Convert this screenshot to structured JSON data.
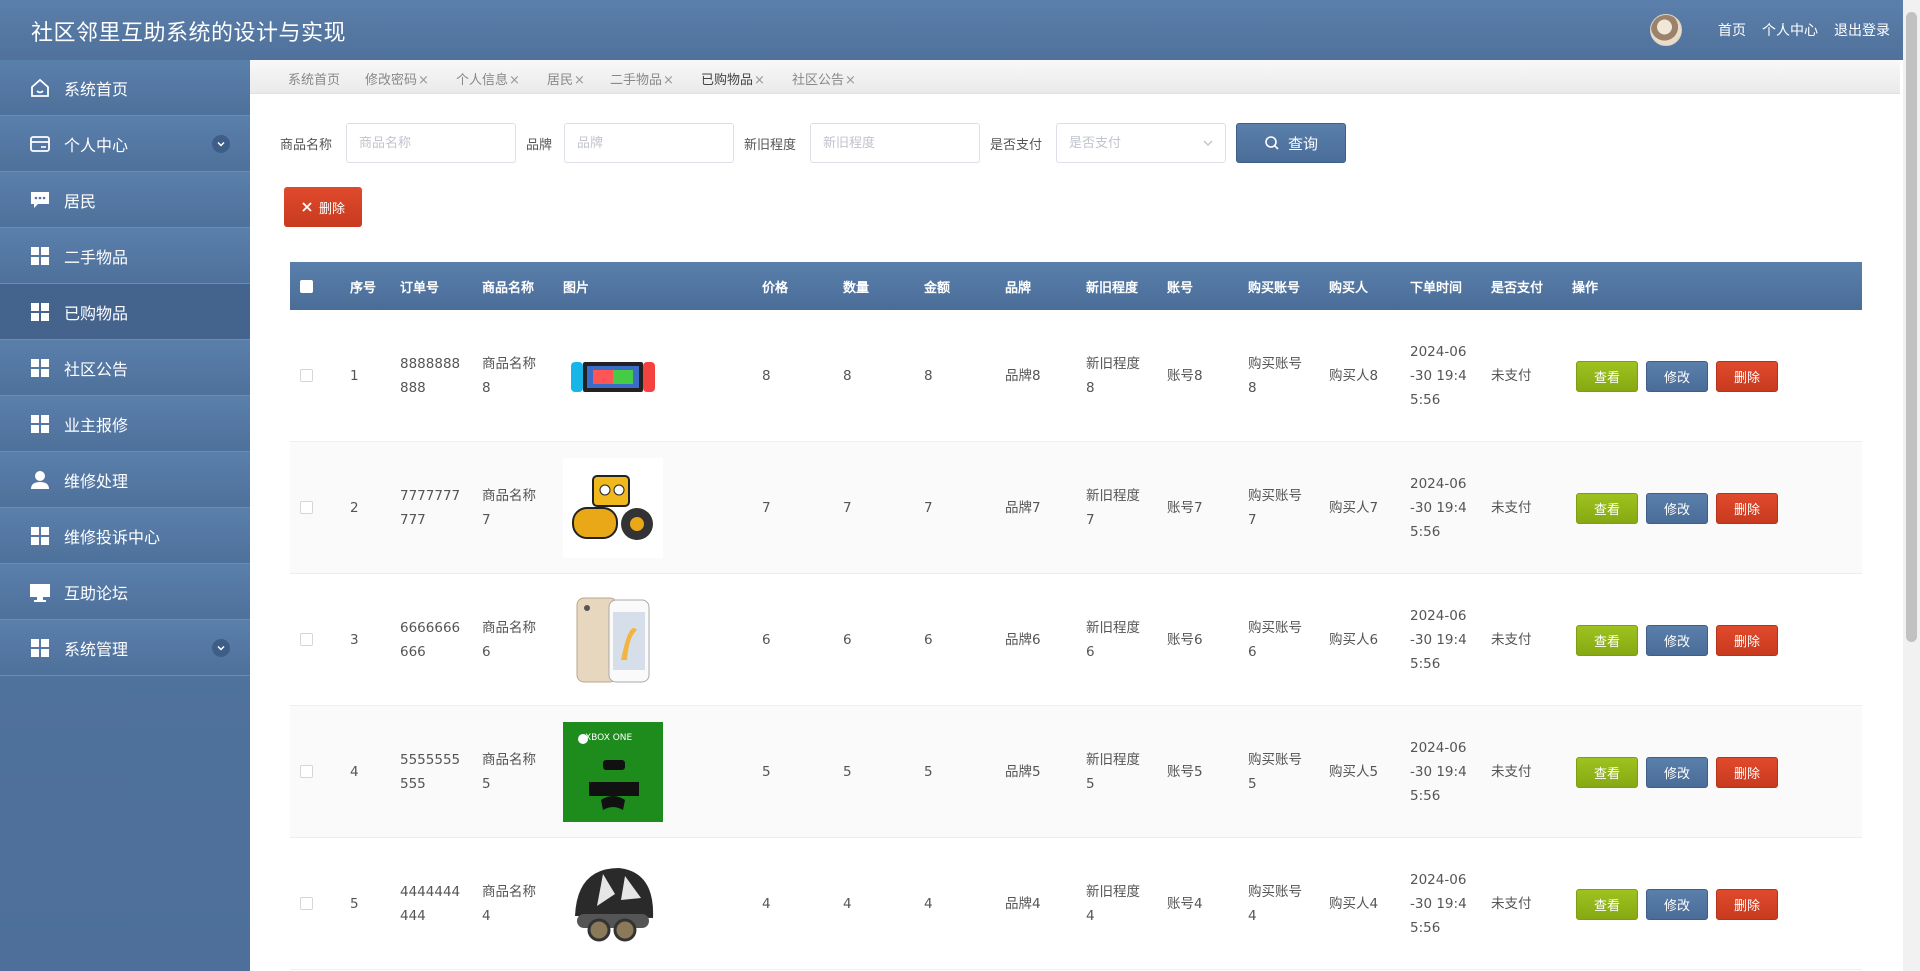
{
  "header": {
    "title": "社区邻里互助系统的设计与实现",
    "links": [
      "首页",
      "个人中心",
      "退出登录"
    ]
  },
  "sidebar": {
    "items": [
      {
        "label": "系统首页",
        "icon": "home-icon"
      },
      {
        "label": "个人中心",
        "icon": "card-icon",
        "expandable": true
      },
      {
        "label": "居民",
        "icon": "chat-icon"
      },
      {
        "label": "二手物品",
        "icon": "grid-icon"
      },
      {
        "label": "已购物品",
        "icon": "grid-icon",
        "active": true
      },
      {
        "label": "社区公告",
        "icon": "grid-icon"
      },
      {
        "label": "业主报修",
        "icon": "grid-icon"
      },
      {
        "label": "维修处理",
        "icon": "user-icon"
      },
      {
        "label": "维修投诉中心",
        "icon": "grid-icon"
      },
      {
        "label": "互助论坛",
        "icon": "monitor-icon"
      },
      {
        "label": "系统管理",
        "icon": "grid-icon",
        "expandable": true
      }
    ]
  },
  "tabs": [
    {
      "label": "系统首页",
      "closable": false
    },
    {
      "label": "修改密码",
      "closable": true
    },
    {
      "label": "个人信息",
      "closable": true
    },
    {
      "label": "居民",
      "closable": true
    },
    {
      "label": "二手物品",
      "closable": true
    },
    {
      "label": "已购物品",
      "closable": true,
      "active": true
    },
    {
      "label": "社区公告",
      "closable": true
    }
  ],
  "search": {
    "name_label": "商品名称",
    "name_placeholder": "商品名称",
    "brand_label": "品牌",
    "brand_placeholder": "品牌",
    "condition_label": "新旧程度",
    "condition_placeholder": "新旧程度",
    "paid_label": "是否支付",
    "paid_placeholder": "是否支付",
    "query_label": "查询"
  },
  "toolbar": {
    "delete_label": "删除"
  },
  "table": {
    "columns": [
      "序号",
      "订单号",
      "商品名称",
      "图片",
      "价格",
      "数量",
      "金额",
      "品牌",
      "新旧程度",
      "账号",
      "购买账号",
      "购买人",
      "下单时间",
      "是否支付",
      "操作"
    ],
    "actions": {
      "view": "查看",
      "edit": "修改",
      "delete": "删除"
    },
    "rows": [
      {
        "no": "1",
        "order": [
          "8888888",
          "888"
        ],
        "name": [
          "商品名称",
          "8"
        ],
        "pic": "game-console-photo",
        "price": "8",
        "qty": "8",
        "amount": "8",
        "brand": "品牌8",
        "cond": [
          "新旧程度",
          "8"
        ],
        "account": "账号8",
        "buyer_acct": [
          "购买账号",
          "8"
        ],
        "buyer": "购买人8",
        "time": [
          "2024-06",
          "-30 19:4",
          "5:56"
        ],
        "paid": "未支付"
      },
      {
        "no": "2",
        "order": [
          "7777777",
          "777"
        ],
        "name": [
          "商品名称",
          "7"
        ],
        "pic": "road-roller-toy-photo",
        "price": "7",
        "qty": "7",
        "amount": "7",
        "brand": "品牌7",
        "cond": [
          "新旧程度",
          "7"
        ],
        "account": "账号7",
        "buyer_acct": [
          "购买账号",
          "7"
        ],
        "buyer": "购买人7",
        "time": [
          "2024-06",
          "-30 19:4",
          "5:56"
        ],
        "paid": "未支付"
      },
      {
        "no": "3",
        "order": [
          "6666666",
          "666"
        ],
        "name": [
          "商品名称",
          "6"
        ],
        "pic": "smartphone-photo",
        "price": "6",
        "qty": "6",
        "amount": "6",
        "brand": "品牌6",
        "cond": [
          "新旧程度",
          "6"
        ],
        "account": "账号6",
        "buyer_acct": [
          "购买账号",
          "6"
        ],
        "buyer": "购买人6",
        "time": [
          "2024-06",
          "-30 19:4",
          "5:56"
        ],
        "paid": "未支付"
      },
      {
        "no": "4",
        "order": [
          "5555555",
          "555"
        ],
        "name": [
          "商品名称",
          "5"
        ],
        "pic": "xbox-one-photo",
        "pic_text": "XBOX ONE",
        "price": "5",
        "qty": "5",
        "amount": "5",
        "brand": "品牌5",
        "cond": [
          "新旧程度",
          "5"
        ],
        "account": "账号5",
        "buyer_acct": [
          "购买账号",
          "5"
        ],
        "buyer": "购买人5",
        "time": [
          "2024-06",
          "-30 19:4",
          "5:56"
        ],
        "paid": "未支付"
      },
      {
        "no": "5",
        "order": [
          "4444444",
          "444"
        ],
        "name": [
          "商品名称",
          "4"
        ],
        "pic": "helmet-photo",
        "price": "4",
        "qty": "4",
        "amount": "4",
        "brand": "品牌4",
        "cond": [
          "新旧程度",
          "4"
        ],
        "account": "账号4",
        "buyer_acct": [
          "购买账号",
          "4"
        ],
        "buyer": "购买人4",
        "time": [
          "2024-06",
          "-30 19:4",
          "5:56"
        ],
        "paid": "未支付"
      }
    ]
  },
  "colors": {
    "primary": "#5274a0",
    "success": "#92b619",
    "danger": "#d5412a"
  }
}
